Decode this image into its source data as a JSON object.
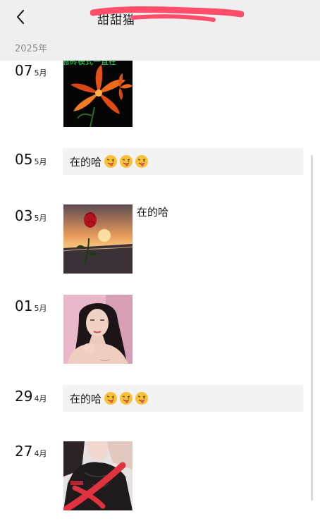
{
  "header": {
    "title": "甜甜猫",
    "back_icon": "chevron-left-icon",
    "background": "#efefef"
  },
  "year_label": "2025年",
  "posts": [
    {
      "day": "07",
      "month": "5月",
      "type": "image",
      "image": "orange-lily-flower-with-green-caption",
      "image_caption": "搬砖模式一直在"
    },
    {
      "day": "05",
      "month": "5月",
      "type": "text",
      "text": "在的哈",
      "emoji": [
        "winking-face-tongue-icon",
        "winking-face-tongue-icon",
        "winking-face-tongue-icon"
      ]
    },
    {
      "day": "03",
      "month": "5月",
      "type": "image-with-text",
      "image": "red-rose-at-sunset-beach",
      "text": "在的哈"
    },
    {
      "day": "01",
      "month": "5月",
      "type": "image",
      "image": "woman-portrait-pink-background"
    },
    {
      "day": "29",
      "month": "4月",
      "type": "text",
      "text": "在的哈",
      "emoji": [
        "winking-face-tongue-icon",
        "winking-face-tongue-icon",
        "winking-face-tongue-icon"
      ]
    },
    {
      "day": "27",
      "month": "4月",
      "type": "image",
      "image": "woman-in-dark-lace-top-redacted"
    }
  ],
  "colors": {
    "redaction": "#ff4d6a",
    "bubble": "#f3f3f3",
    "caption_green": "#2fd15a"
  }
}
